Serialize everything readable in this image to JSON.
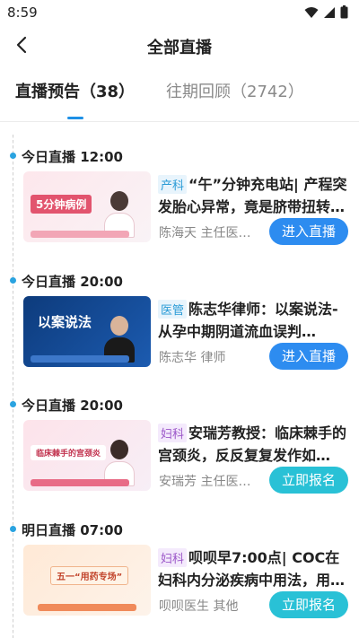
{
  "status": {
    "time": "8:59"
  },
  "header": {
    "title": "全部直播"
  },
  "tabs": {
    "live": "直播预告（38）",
    "replay": "往期回顾（2742）"
  },
  "items": [
    {
      "time_label": "今日直播 12:00",
      "tag": "产科",
      "title": "“午”分钟充电站| 产程突发胎心异常，竟是脐带扭转…",
      "host": "陈海天 主任医…",
      "button": "进入直播",
      "thumb_text": "5分钟病例"
    },
    {
      "time_label": "今日直播 20:00",
      "tag": "医管",
      "title": "陈志华律师：以案说法-从孕中期阴道流血误判…",
      "host": "陈志华 律师",
      "button": "进入直播",
      "thumb_text": "以案说法"
    },
    {
      "time_label": "今日直播 20:00",
      "tag": "妇科",
      "title": "安瑞芳教授：临床棘手的宫颈炎，反反复复发作如…",
      "host": "安瑞芳 主任医…",
      "button": "立即报名",
      "thumb_text": "临床棘手的宫颈炎"
    },
    {
      "time_label": "明日直播 07:00",
      "tag": "妇科",
      "title": "呗呗早7:00点| COC在妇科内分泌疾病中用法，用…",
      "host": "呗呗医生 其他",
      "button": "立即报名",
      "thumb_text": "五一“用药专场”"
    }
  ]
}
